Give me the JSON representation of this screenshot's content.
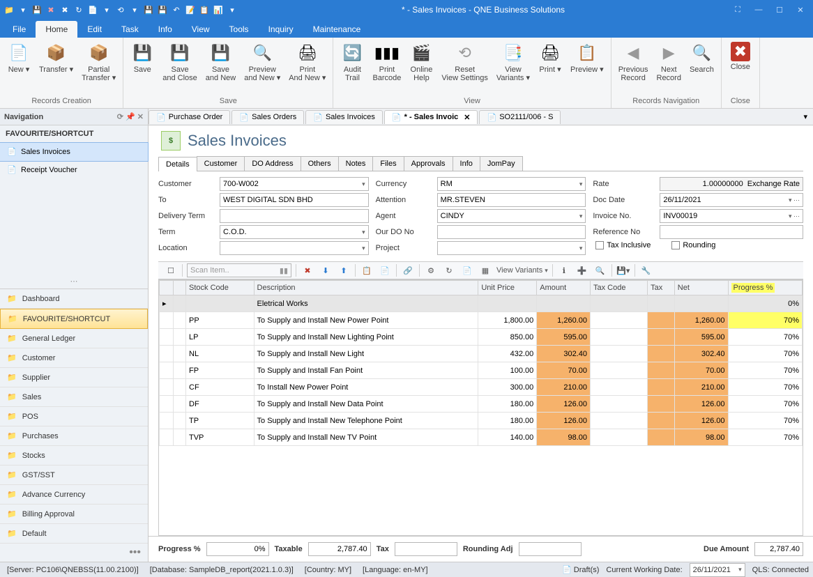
{
  "window": {
    "title": "*  - Sales Invoices - QNE Business Solutions"
  },
  "menubar": [
    "File",
    "Home",
    "Edit",
    "Task",
    "Info",
    "View",
    "Tools",
    "Inquiry",
    "Maintenance"
  ],
  "menubar_active": "Home",
  "ribbon": {
    "groups": [
      {
        "caption": "Records Creation",
        "buttons": [
          {
            "label": "New",
            "icon": "📄",
            "dd": true
          },
          {
            "label": "Transfer",
            "icon": "📦",
            "dd": true
          },
          {
            "label": "Partial Transfer",
            "icon": "📦",
            "dd": true
          }
        ]
      },
      {
        "caption": "Save",
        "buttons": [
          {
            "label": "Save",
            "icon": "💾"
          },
          {
            "label": "Save and Close",
            "icon": "💾"
          },
          {
            "label": "Save and New",
            "icon": "💾"
          },
          {
            "label": "Preview and New",
            "icon": "🔍",
            "dd": true
          },
          {
            "label": "Print And New",
            "icon": "🖨",
            "dd": true
          }
        ]
      },
      {
        "caption": "View",
        "buttons": [
          {
            "label": "Audit Trail",
            "icon": "🔄"
          },
          {
            "label": "Print Barcode",
            "icon": "▮▮▮"
          },
          {
            "label": "Online Help",
            "icon": "🎬"
          },
          {
            "label": "Reset View Settings",
            "icon": "⟲",
            "disabled": true
          },
          {
            "label": "View Variants",
            "icon": "📑",
            "dd": true
          },
          {
            "label": "Print",
            "icon": "🖨",
            "dd": true
          },
          {
            "label": "Preview",
            "icon": "📋",
            "dd": true
          }
        ]
      },
      {
        "caption": "Records Navigation",
        "buttons": [
          {
            "label": "Previous Record",
            "icon": "◀",
            "disabled": true
          },
          {
            "label": "Next Record",
            "icon": "▶",
            "disabled": true
          },
          {
            "label": "Search",
            "icon": "🔍"
          }
        ]
      },
      {
        "caption": "Close",
        "buttons": [
          {
            "label": "Close",
            "icon": "✖",
            "red": true
          }
        ]
      }
    ]
  },
  "nav": {
    "header": "Navigation",
    "fav_header": "FAVOURITE/SHORTCUT",
    "fav_items": [
      {
        "label": "Sales Invoices",
        "sel": true
      },
      {
        "label": "Receipt Voucher"
      }
    ],
    "sections": [
      "Dashboard",
      "FAVOURITE/SHORTCUT",
      "General Ledger",
      "Customer",
      "Supplier",
      "Sales",
      "POS",
      "Purchases",
      "Stocks",
      "GST/SST",
      "Advance Currency",
      "Billing Approval",
      "Default"
    ],
    "active_section": "FAVOURITE/SHORTCUT"
  },
  "doctabs": [
    {
      "label": "Purchase Order"
    },
    {
      "label": "Sales Orders"
    },
    {
      "label": "Sales Invoices"
    },
    {
      "label": "*  - Sales Invoic",
      "active": true,
      "closable": true
    },
    {
      "label": "SO2111/006 - S"
    }
  ],
  "page": {
    "title": "Sales Invoices"
  },
  "formtabs": [
    "Details",
    "Customer",
    "DO Address",
    "Others",
    "Notes",
    "Files",
    "Approvals",
    "Info",
    "JomPay"
  ],
  "formtab_active": "Details",
  "fields": {
    "customer_label": "Customer",
    "customer": "700-W002",
    "to_label": "To",
    "to": "WEST DIGITAL SDN BHD",
    "delivery_term_label": "Delivery Term",
    "delivery_term": "",
    "term_label": "Term",
    "term": "C.O.D.",
    "location_label": "Location",
    "location": "",
    "currency_label": "Currency",
    "currency": "RM",
    "attention_label": "Attention",
    "attention": "MR.STEVEN",
    "agent_label": "Agent",
    "agent": "CINDY",
    "ourdo_label": "Our DO No",
    "ourdo": "",
    "project_label": "Project",
    "project": "",
    "rate_label": "Rate",
    "rate": "1.00000000",
    "rate_suffix": "Exchange Rate",
    "docdate_label": "Doc Date",
    "docdate": "26/11/2021",
    "invoice_label": "Invoice No.",
    "invoice": "INV00019",
    "ref_label": "Reference No",
    "ref": "",
    "tax_inclusive": "Tax Inclusive",
    "rounding": "Rounding"
  },
  "grid_toolbar": {
    "scan_placeholder": "Scan Item..",
    "view_variants": "View Variants"
  },
  "grid": {
    "columns": [
      "",
      "",
      "Stock Code",
      "Description",
      "Unit Price",
      "Amount",
      "Tax Code",
      "Tax",
      "Net",
      "Progress %"
    ],
    "rows": [
      {
        "header": true,
        "desc": "Eletrical Works",
        "progress": "0%"
      },
      {
        "code": "PP",
        "desc": "To Supply and Install New Power Point",
        "price": "1,800.00",
        "amount": "1,260.00",
        "net": "1,260.00",
        "progress": "70%",
        "prog_hl": true
      },
      {
        "code": "LP",
        "desc": "To Supply and Install New Lighting Point",
        "price": "850.00",
        "amount": "595.00",
        "net": "595.00",
        "progress": "70%"
      },
      {
        "code": "NL",
        "desc": "To Supply and Install New Light",
        "price": "432.00",
        "amount": "302.40",
        "net": "302.40",
        "progress": "70%"
      },
      {
        "code": "FP",
        "desc": "To Supply and Install Fan Point",
        "price": "100.00",
        "amount": "70.00",
        "net": "70.00",
        "progress": "70%"
      },
      {
        "code": "CF",
        "desc": "To Install New Power Point",
        "price": "300.00",
        "amount": "210.00",
        "net": "210.00",
        "progress": "70%"
      },
      {
        "code": "DF",
        "desc": "To Supply and Install New Data Point",
        "price": "180.00",
        "amount": "126.00",
        "net": "126.00",
        "progress": "70%"
      },
      {
        "code": "TP",
        "desc": "To Supply and Install New Telephone Point",
        "price": "180.00",
        "amount": "126.00",
        "net": "126.00",
        "progress": "70%"
      },
      {
        "code": "TVP",
        "desc": "To Supply and Install New TV Point",
        "price": "140.00",
        "amount": "98.00",
        "net": "98.00",
        "progress": "70%"
      }
    ]
  },
  "totals": {
    "progress_label": "Progress %",
    "progress": "0%",
    "taxable_label": "Taxable",
    "taxable": "2,787.40",
    "tax_label": "Tax",
    "tax": "",
    "rounding_label": "Rounding Adj",
    "rounding": "",
    "due_label": "Due Amount",
    "due": "2,787.40"
  },
  "status": {
    "server": "[Server: PC106\\QNEBSS(11.00.2100)]",
    "db": "[Database: SampleDB_report(2021.1.0.3)]",
    "country": "[Country: MY]",
    "lang": "[Language: en-MY]",
    "drafts": "Draft(s)",
    "cwd_label": "Current Working Date:",
    "cwd": "26/11/2021",
    "qls": "QLS: Connected"
  }
}
